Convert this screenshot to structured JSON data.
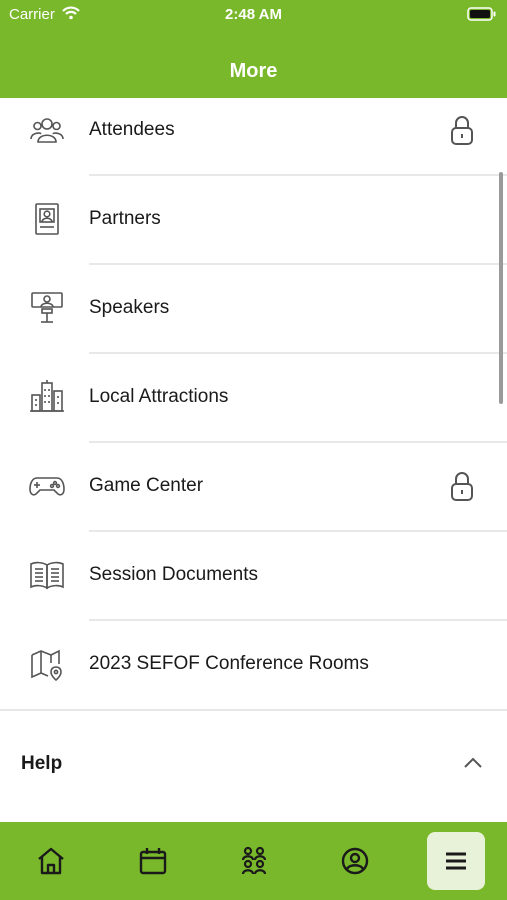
{
  "status_bar": {
    "carrier": "Carrier",
    "time": "2:48 AM"
  },
  "nav": {
    "title": "More"
  },
  "menu_items": [
    {
      "label": "Attendees",
      "icon": "attendees-icon",
      "locked": true
    },
    {
      "label": "Partners",
      "icon": "partners-icon",
      "locked": false
    },
    {
      "label": "Speakers",
      "icon": "speakers-icon",
      "locked": false
    },
    {
      "label": "Local Attractions",
      "icon": "buildings-icon",
      "locked": false
    },
    {
      "label": "Game Center",
      "icon": "gamepad-icon",
      "locked": true
    },
    {
      "label": "Session Documents",
      "icon": "book-icon",
      "locked": false
    },
    {
      "label": "2023 SEFOF Conference Rooms",
      "icon": "map-pin-icon",
      "locked": false
    }
  ],
  "help": {
    "label": "Help"
  },
  "tabs": [
    {
      "icon": "home-icon",
      "active": false
    },
    {
      "icon": "calendar-icon",
      "active": false
    },
    {
      "icon": "people-icon",
      "active": false
    },
    {
      "icon": "profile-icon",
      "active": false
    },
    {
      "icon": "menu-icon",
      "active": true
    }
  ],
  "colors": {
    "brand_green": "#79b72b",
    "active_tab_bg": "#e8f2d8"
  }
}
